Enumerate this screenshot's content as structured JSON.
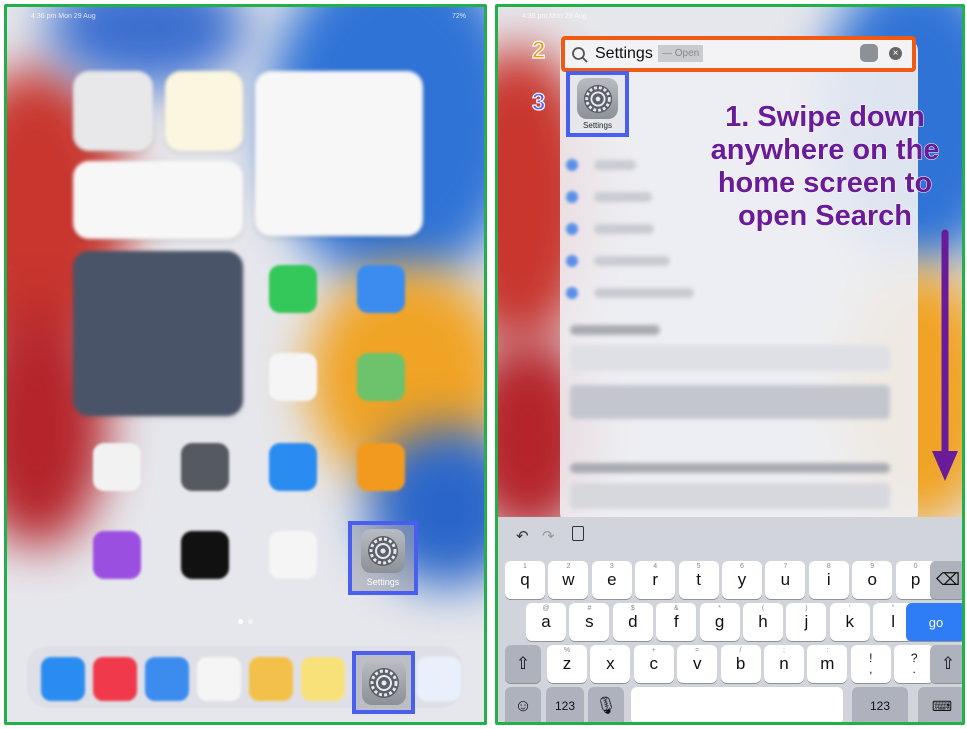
{
  "left_panel": {
    "status_time": "4:36 pm  Mon 29 Aug",
    "status_battery": "72%",
    "settings_app_label": "Settings"
  },
  "right_panel": {
    "status_time": "4:36 pm  Mon 29 Aug",
    "search": {
      "query": "Settings",
      "suggestion": "— Open"
    },
    "top_hit_label": "Settings",
    "step_numbers": {
      "step2": "2",
      "step3": "3"
    },
    "instruction": "1. Swipe down anywhere on the home screen to open Search",
    "keyboard": {
      "row1": [
        {
          "k": "q",
          "s": "1"
        },
        {
          "k": "w",
          "s": "2"
        },
        {
          "k": "e",
          "s": "3"
        },
        {
          "k": "r",
          "s": "4"
        },
        {
          "k": "t",
          "s": "5"
        },
        {
          "k": "y",
          "s": "6"
        },
        {
          "k": "u",
          "s": "7"
        },
        {
          "k": "i",
          "s": "8"
        },
        {
          "k": "o",
          "s": "9"
        },
        {
          "k": "p",
          "s": "0"
        }
      ],
      "row2": [
        {
          "k": "a",
          "s": "@"
        },
        {
          "k": "s",
          "s": "#"
        },
        {
          "k": "d",
          "s": "$"
        },
        {
          "k": "f",
          "s": "&"
        },
        {
          "k": "g",
          "s": "*"
        },
        {
          "k": "h",
          "s": "("
        },
        {
          "k": "j",
          "s": ")"
        },
        {
          "k": "k",
          "s": "'"
        },
        {
          "k": "l",
          "s": "\""
        }
      ],
      "row3": [
        {
          "k": "z",
          "s": "%"
        },
        {
          "k": "x",
          "s": "-"
        },
        {
          "k": "c",
          "s": "+"
        },
        {
          "k": "v",
          "s": "="
        },
        {
          "k": "b",
          "s": "/"
        },
        {
          "k": "n",
          "s": ";"
        },
        {
          "k": "m",
          "s": ":"
        },
        {
          "k": "!\n,",
          "s": ""
        },
        {
          "k": "?\n.",
          "s": ""
        }
      ],
      "go_label": "go",
      "numbers_label": "123"
    }
  },
  "colors": {
    "frame": "#22b04b",
    "highlight": "#4a5ff0",
    "search_highlight": "#f05a12",
    "instruction_text": "#6a1b9a",
    "arrow": "#6a1b9a",
    "go_key": "#2e7cf6"
  }
}
